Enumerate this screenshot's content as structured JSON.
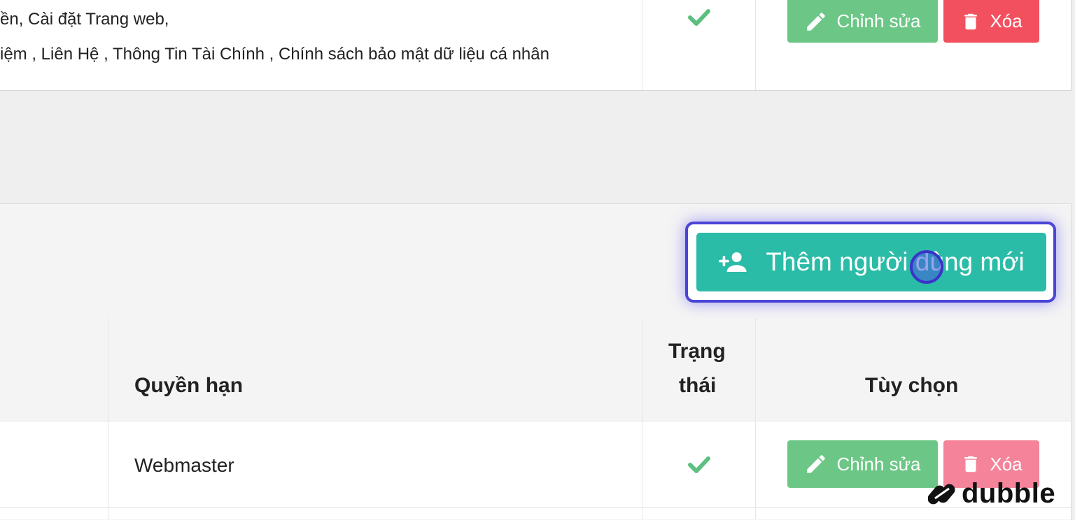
{
  "previous_row": {
    "permissions_line1": "ền, Cài đặt Trang web,",
    "permissions_line2": "iệm , Liên Hệ , Thông Tin Tài Chính , Chính sách bảo mật dữ liệu cá nhân",
    "status_icon": "check-icon",
    "edit_label": "Chỉnh sửa",
    "delete_label": "Xóa"
  },
  "users_section": {
    "add_user_label": "Thêm người dùng mới",
    "columns": {
      "permission": "Quyền hạn",
      "status_line1": "Trạng",
      "status_line2": "thái",
      "options": "Tùy chọn"
    },
    "rows": [
      {
        "permission": "Webmaster",
        "status_icon": "check-icon",
        "edit_label": "Chỉnh sửa",
        "delete_label": "Xóa"
      }
    ]
  },
  "watermark": {
    "text": "dubble"
  },
  "colors": {
    "edit": "#6cc786",
    "delete": "#f3505f",
    "add": "#2bbca8",
    "highlight": "#4b45d6",
    "check": "#5cc07e"
  }
}
